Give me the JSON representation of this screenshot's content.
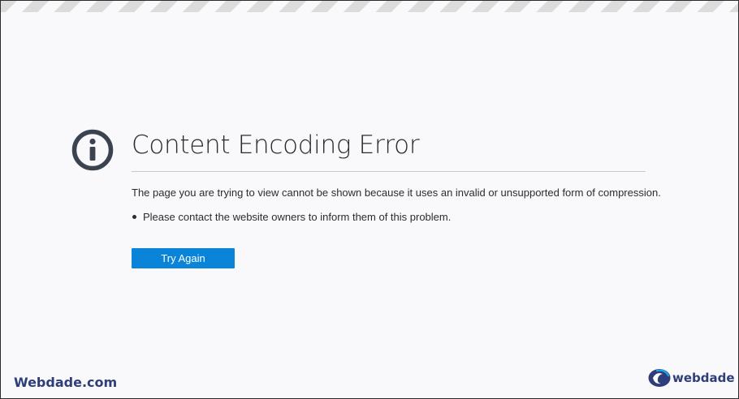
{
  "error_page": {
    "icon": "info-icon",
    "title": "Content Encoding Error",
    "description": "The page you are trying to view cannot be shown because it uses an invalid or unsupported form of compression.",
    "bullets": [
      "Please contact the website owners to inform them of this problem."
    ],
    "try_again_label": "Try Again"
  },
  "watermarks": {
    "left_text": "Webdade.com",
    "right_text": "webdade",
    "right_logo_icon": "webdade-logo-icon"
  },
  "colors": {
    "background": "#f9f9fb",
    "text": "#2b2b33",
    "button": "#0a84d8",
    "brand": "#2d3e7a"
  }
}
